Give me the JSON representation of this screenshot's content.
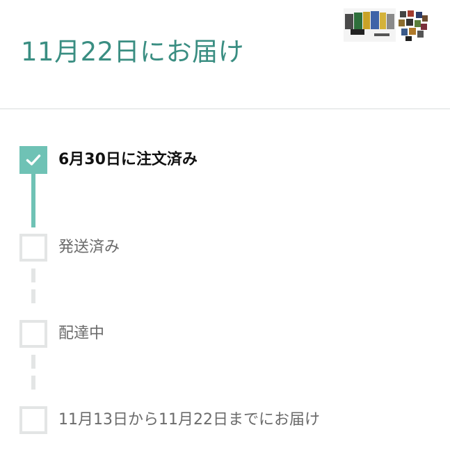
{
  "colors": {
    "accent": "#3a8e82",
    "progress": "#6fc2b5",
    "label_done": "#111111",
    "label_pending": "#6b6b6b",
    "pending_line": "#e3e5e5"
  },
  "header": {
    "delivery_date": "11月22日にお届け"
  },
  "tracker": {
    "steps": [
      {
        "label": "6月30日に注文済み",
        "status": "done",
        "icon": "checkmark-icon"
      },
      {
        "label": "発送済み",
        "status": "pending",
        "icon": "empty-box-icon"
      },
      {
        "label": "配達中",
        "status": "pending",
        "icon": "empty-box-icon"
      },
      {
        "label": "11月13日から11月22日までにお届け",
        "status": "pending",
        "icon": "empty-box-icon"
      }
    ]
  }
}
